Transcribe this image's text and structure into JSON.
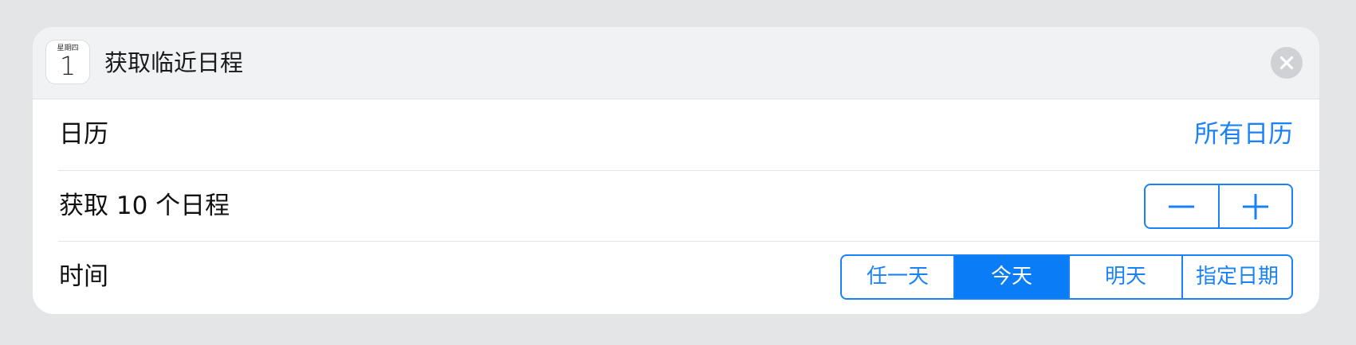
{
  "action": {
    "title": "获取临近日程",
    "icon": {
      "name": "calendar-icon",
      "weekday": "星期四",
      "day": "1"
    }
  },
  "rows": {
    "calendar": {
      "label": "日历",
      "value": "所有日历"
    },
    "count": {
      "label": "获取 10 个日程",
      "value": 10
    },
    "time": {
      "label": "时间",
      "options": [
        "任一天",
        "今天",
        "明天",
        "指定日期"
      ],
      "selected": "今天"
    }
  },
  "colors": {
    "accent": "#1a82f7",
    "header_bg": "#f1f2f4",
    "page_bg": "#e4e5e7"
  }
}
